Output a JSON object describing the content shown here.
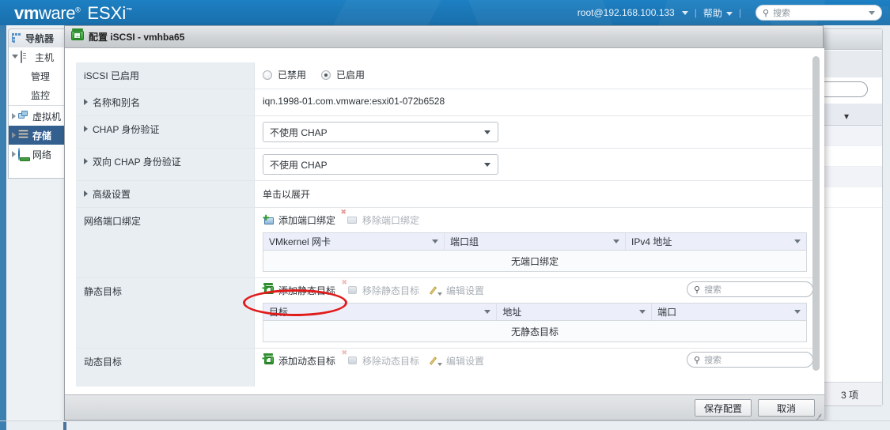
{
  "topbar": {
    "brand_vm": "vm",
    "brand_ware": "ware",
    "brand_reg": "®",
    "brand_product": "ESXi",
    "brand_tm": "™",
    "user": "root@192.168.100.133",
    "separator": "|",
    "help": "帮助",
    "search_placeholder": "搜索",
    "search_icon": "search-icon"
  },
  "navigator": {
    "tab_label": "导航器",
    "items": [
      {
        "label": "主机",
        "icon": "host-icon",
        "expanded": true,
        "selected": false,
        "indent": false
      },
      {
        "label": "管理",
        "icon": "",
        "expanded": false,
        "selected": false,
        "indent": true
      },
      {
        "label": "监控",
        "icon": "",
        "expanded": false,
        "selected": false,
        "indent": true
      },
      {
        "label": "虚拟机",
        "icon": "vm-icon",
        "expanded": false,
        "selected": false,
        "indent": false
      },
      {
        "label": "存储",
        "icon": "storage-icon",
        "expanded": false,
        "selected": true,
        "indent": false
      },
      {
        "label": "网络",
        "icon": "network-icon",
        "expanded": false,
        "selected": false,
        "indent": false
      }
    ]
  },
  "background_panel": {
    "item_count": "3 项"
  },
  "dialog": {
    "title": "配置 iSCSI - vmhba65",
    "title_icon": "iscsi-adapter-icon",
    "rows": {
      "iscsi_enabled": {
        "label": "iSCSI 已启用",
        "option_disabled": "已禁用",
        "option_enabled": "已启用",
        "selected": "已启用"
      },
      "name_alias": {
        "label": "名称和别名",
        "value": "iqn.1998-01.com.vmware:esxi01-072b6528"
      },
      "chap": {
        "label": "CHAP 身份验证",
        "value": "不使用 CHAP"
      },
      "mutual_chap": {
        "label": "双向 CHAP 身份验证",
        "value": "不使用 CHAP"
      },
      "advanced": {
        "label": "高级设置",
        "value": "单击以展开"
      },
      "port_binding": {
        "label": "网络端口绑定",
        "add_label": "添加端口绑定",
        "add_icon": "add-port-binding-icon",
        "remove_label": "移除端口绑定",
        "remove_icon": "remove-port-binding-icon",
        "columns": [
          "VMkernel 网卡",
          "端口组",
          "IPv4 地址"
        ],
        "empty_text": "无端口绑定"
      },
      "static_targets": {
        "label": "静态目标",
        "add_label": "添加静态目标",
        "add_icon": "add-static-target-icon",
        "remove_label": "移除静态目标",
        "remove_icon": "remove-static-target-icon",
        "edit_label": "编辑设置",
        "edit_icon": "pencil-icon",
        "search_placeholder": "搜索",
        "search_icon": "search-icon",
        "columns": [
          "目标",
          "地址",
          "端口"
        ],
        "empty_text": "无静态目标"
      },
      "dynamic_targets": {
        "label": "动态目标",
        "add_label": "添加动态目标",
        "add_icon": "add-dynamic-target-icon",
        "remove_label": "移除动态目标",
        "remove_icon": "remove-dynamic-target-icon",
        "edit_label": "编辑设置",
        "edit_icon": "pencil-icon",
        "search_placeholder": "搜索",
        "search_icon": "search-icon"
      }
    },
    "footer": {
      "save_label": "保存配置",
      "cancel_label": "取消"
    }
  },
  "annotation": {
    "shape": "ellipse",
    "color": "#e11b1b",
    "targets": "添加静态目标"
  }
}
